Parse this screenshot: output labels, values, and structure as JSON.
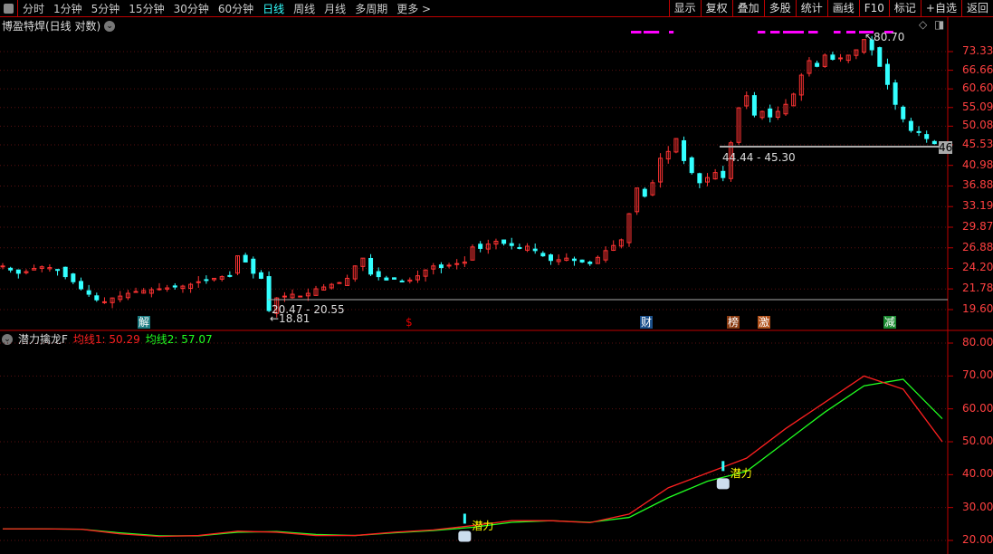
{
  "toolbar": {
    "periods": [
      "分时",
      "1分钟",
      "5分钟",
      "15分钟",
      "30分钟",
      "60分钟",
      "日线",
      "周线",
      "月线",
      "多周期",
      "更多 >"
    ],
    "active": "日线",
    "right_buttons": [
      "显示",
      "复权",
      "叠加",
      "多股",
      "统计",
      "画线",
      "F10",
      "标记",
      "+自选",
      "返回"
    ]
  },
  "main_chart": {
    "title": "博盈特焊(日线 对数)",
    "y_ticks": [
      "73.33",
      "66.66",
      "60.60",
      "55.09",
      "50.08",
      "45.53",
      "40.98",
      "36.88",
      "33.19",
      "29.87",
      "26.88",
      "24.20",
      "21.78",
      "19.60"
    ],
    "high_label": "80.70",
    "low_label": "18.81",
    "range1": "20.47 - 20.55",
    "range2": "44.44 - 45.30",
    "last_price_tag": "46",
    "scale": "log",
    "badges": [
      {
        "text": "解",
        "color": "#1a7a80"
      },
      {
        "text": "$",
        "color": "#e00000"
      },
      {
        "text": "财",
        "color": "#1a4f8a"
      },
      {
        "text": "榜",
        "color": "#8a3a10"
      },
      {
        "text": "激",
        "color": "#b0501a"
      },
      {
        "text": "减",
        "color": "#1a8a30"
      }
    ]
  },
  "indicator": {
    "name": "潜力擒龙F",
    "ma1_label": "均线1: 50.29",
    "ma2_label": "均线2: 57.07",
    "signal_label": "潜力",
    "y_ticks": [
      "80.00",
      "70.00",
      "60.00",
      "50.00",
      "40.00",
      "30.00",
      "20.00"
    ]
  },
  "colors": {
    "up": "#ff3333",
    "down": "#33ffff",
    "ma1": "#ff2020",
    "ma2": "#20ff20",
    "magenta": "#ff00ff"
  },
  "chart_data": {
    "type": "candlestick",
    "closes": [
      24.5,
      24.0,
      23.6,
      23.8,
      24.2,
      24.4,
      24.3,
      24.0,
      23.2,
      22.6,
      21.8,
      21.2,
      20.6,
      20.4,
      20.8,
      21.0,
      21.3,
      21.5,
      21.6,
      21.7,
      21.8,
      21.9,
      22.0,
      22.1,
      22.3,
      22.6,
      22.8,
      23.0,
      23.2,
      23.3,
      25.8,
      25.0,
      23.6,
      23.0,
      19.5,
      20.8,
      21.0,
      21.2,
      21.0,
      21.3,
      21.8,
      22.0,
      22.3,
      22.5,
      23.0,
      24.5,
      25.5,
      23.5,
      23.2,
      22.8,
      22.9,
      22.6,
      22.8,
      23.3,
      24.0,
      24.5,
      24.3,
      24.6,
      24.8,
      25.0,
      27.0,
      26.8,
      27.4,
      27.8,
      27.5,
      27.2,
      26.8,
      27.1,
      26.5,
      25.8,
      25.2,
      25.3,
      25.5,
      25.2,
      25.0,
      24.8,
      25.6,
      26.5,
      27.2,
      28.0,
      32.0,
      36.5,
      35.0,
      37.5,
      42.5,
      44.0,
      47.0,
      42.0,
      39.5,
      37.5,
      38.5,
      39.5,
      38.5,
      46.0,
      55.0,
      58.5,
      53.0,
      54.0,
      52.5,
      54.0,
      56.0,
      59.0,
      65.0,
      70.0,
      68.0,
      72.0,
      70.5,
      71.0,
      72.0,
      74.0,
      78.0,
      74.0,
      68.0,
      62.0,
      56.0,
      52.0,
      49.0,
      48.5,
      47.0,
      45.8
    ],
    "ma1_every5": [
      23.5,
      23.5,
      23.4,
      22.0,
      21.2,
      21.5,
      22.8,
      22.5,
      21.5,
      21.5,
      22.5,
      23.2,
      24.5,
      26,
      26,
      25.4,
      28,
      36,
      40.5,
      45,
      54,
      62,
      70,
      66,
      50
    ],
    "ma2_every5": [
      23.5,
      23.5,
      23.4,
      22.3,
      21.4,
      21.4,
      22.5,
      22.7,
      21.8,
      21.5,
      22.3,
      23,
      24,
      25.5,
      26,
      25.5,
      27,
      33,
      38,
      41,
      50,
      59,
      67,
      69,
      57
    ],
    "signals_at": [
      59,
      92
    ]
  }
}
